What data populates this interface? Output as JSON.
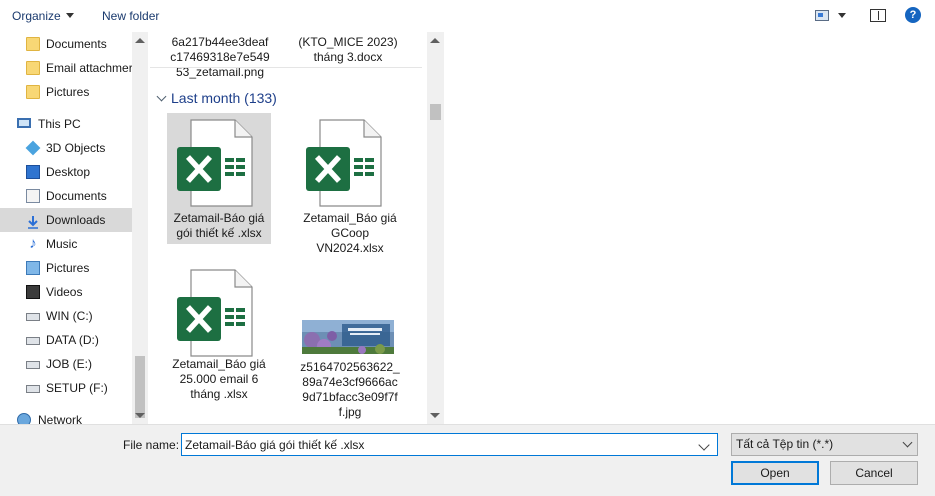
{
  "toolbar": {
    "organize_label": "Organize",
    "new_folder_label": "New folder",
    "help_label": "?"
  },
  "nav": {
    "items": [
      {
        "label": "Documents",
        "icon": "folder-icon"
      },
      {
        "label": "Email attachmer",
        "icon": "folder-icon"
      },
      {
        "label": "Pictures",
        "icon": "folder-icon"
      },
      {
        "label": "This PC",
        "icon": "computer-icon"
      },
      {
        "label": "3D Objects",
        "icon": "cube-icon"
      },
      {
        "label": "Desktop",
        "icon": "desktop-icon"
      },
      {
        "label": "Documents",
        "icon": "documents-icon"
      },
      {
        "label": "Downloads",
        "icon": "download-arrow-icon"
      },
      {
        "label": "Music",
        "icon": "music-note-icon"
      },
      {
        "label": "Pictures",
        "icon": "pictures-icon"
      },
      {
        "label": "Videos",
        "icon": "film-icon"
      },
      {
        "label": "WIN (C:)",
        "icon": "drive-icon"
      },
      {
        "label": "DATA (D:)",
        "icon": "drive-icon"
      },
      {
        "label": "JOB (E:)",
        "icon": "drive-icon"
      },
      {
        "label": "SETUP (F:)",
        "icon": "drive-icon"
      },
      {
        "label": "Network",
        "icon": "network-icon"
      }
    ]
  },
  "content": {
    "top_files": [
      {
        "name": "6a217b44ee3deaf\nc17469318e7e549\n53_zetamail.png"
      },
      {
        "name": "(KTO_MICE 2023)\ntháng 3.docx"
      }
    ],
    "group_header": "Last month (133)",
    "files": [
      {
        "name": "Zetamail-Báo giá\ngói thiết kế .xlsx",
        "type": "excel",
        "selected": true
      },
      {
        "name": "Zetamail_Báo giá\nGCoop\nVN2024.xlsx",
        "type": "excel",
        "selected": false
      },
      {
        "name": "Zetamail_Báo giá\n25.000 email 6\ntháng .xlsx",
        "type": "excel",
        "selected": false
      },
      {
        "name": "z5164702563622_\n89a74e3cf9666ac\n9d71bfacc3e09f7f\nf.jpg",
        "type": "image",
        "selected": false
      }
    ]
  },
  "footer": {
    "file_name_label": "File name:",
    "file_name_value": "Zetamail-Báo giá gói thiết kế .xlsx",
    "file_type_value": "Tất cả Tệp tin (*.*)",
    "open_label": "Open",
    "cancel_label": "Cancel"
  },
  "colors": {
    "accent": "#0078d7",
    "excel_green": "#1d6f42",
    "selection": "#d9d9d9"
  }
}
